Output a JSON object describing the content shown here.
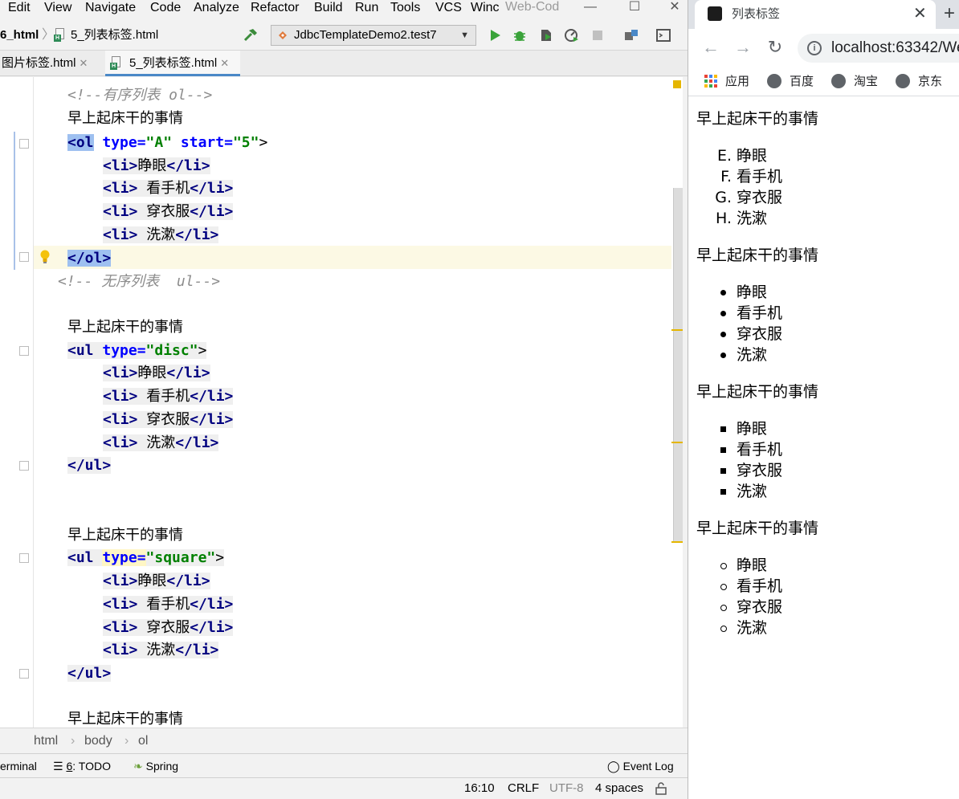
{
  "ide": {
    "menu": [
      "Edit",
      "View",
      "Navigate",
      "Code",
      "Analyze",
      "Refactor",
      "Build",
      "Run",
      "Tools",
      "VCS",
      "Winc"
    ],
    "title_fragment": "Web-Cod",
    "breadcrumb": {
      "folder": "6_html",
      "file": "5_列表标签.html"
    },
    "run_config": "JdbcTemplateDemo2.test7",
    "tabs": [
      {
        "label": "图片标签.html",
        "active": false
      },
      {
        "label": "5_列表标签.html",
        "active": true
      }
    ],
    "code": {
      "comment_ol": "<!--有序列表 ol-->",
      "comment_ul": "<!-- 无序列表  ul-->",
      "heading": "早上起床干的事情",
      "ol_open": {
        "tag": "<ol",
        "attr1": "type=",
        "val1": "\"A\"",
        "attr2": "start=",
        "val2": "\"5\"",
        "close": ">"
      },
      "ul_disc_open": {
        "tag": "<ul",
        "attr": "type=",
        "val": "\"disc\"",
        "close": ">"
      },
      "ul_square_open": {
        "tag": "<ul",
        "attr": "type=",
        "val": "\"square\"",
        "close": ">"
      },
      "li_open": "<li>",
      "li_close": "</li>",
      "ol_close": "</ol>",
      "ul_close": "</ul>",
      "items": [
        "睁眼",
        " 看手机",
        " 穿衣服",
        " 洗漱"
      ]
    },
    "path_crumbs": [
      "html",
      "body",
      "ol"
    ],
    "bottom_tools": {
      "terminal": "erminal",
      "todo_num": "6",
      "todo": ": TODO",
      "spring": "Spring",
      "event_log": "Event Log"
    },
    "status": {
      "position": "16:10",
      "line_sep": "CRLF",
      "encoding": "UTF-8",
      "indent": "4 spaces"
    }
  },
  "browser": {
    "tab_title": "列表标签",
    "url": "localhost:63342/We",
    "bookmarks": [
      "应用",
      "百度",
      "淘宝",
      "京东"
    ],
    "content": {
      "heading": "早上起床干的事情",
      "ol_markers": [
        "E.",
        "F.",
        "G.",
        "H."
      ],
      "items": [
        "睁眼",
        "看手机",
        "穿衣服",
        "洗漱"
      ]
    }
  }
}
